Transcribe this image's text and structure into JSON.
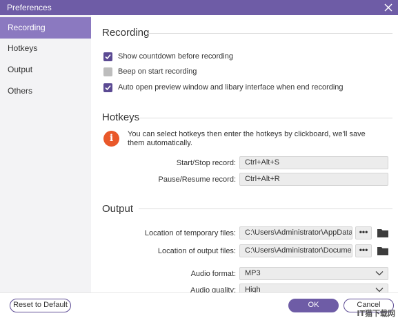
{
  "window": {
    "title": "Preferences"
  },
  "sidebar": {
    "items": [
      {
        "label": "Recording",
        "active": true
      },
      {
        "label": "Hotkeys",
        "active": false
      },
      {
        "label": "Output",
        "active": false
      },
      {
        "label": "Others",
        "active": false
      }
    ]
  },
  "recording": {
    "title": "Recording",
    "options": [
      {
        "label": "Show countdown before recording",
        "checked": true
      },
      {
        "label": "Beep on start recording",
        "checked": false
      },
      {
        "label": "Auto open preview window and libary interface when end recording",
        "checked": true
      }
    ]
  },
  "hotkeys": {
    "title": "Hotkeys",
    "info": "You can select hotkeys then enter the hotkeys by clickboard, we'll save them automatically.",
    "start_stop_label": "Start/Stop record:",
    "start_stop_value": "Ctrl+Alt+S",
    "pause_resume_label": "Pause/Resume record:",
    "pause_resume_value": "Ctrl+Alt+R"
  },
  "output": {
    "title": "Output",
    "temp_label": "Location of temporary files:",
    "temp_value": "C:\\Users\\Administrator\\AppData\\Lo",
    "output_label": "Location of output files:",
    "output_value": "C:\\Users\\Administrator\\Documents",
    "dots": "•••",
    "audio_format_label": "Audio format:",
    "audio_format_value": "MP3",
    "audio_quality_label": "Audio quality:",
    "audio_quality_value": "High"
  },
  "footer": {
    "reset_label": "Reset to Default",
    "ok_label": "OK",
    "cancel_label": "Cancel",
    "watermark": "IT猫下载网"
  },
  "colors": {
    "accent": "#6e5ca6",
    "sidebar_active": "#8b79c0",
    "checkbox_on": "#5b4a93",
    "info_orange": "#e9582a"
  },
  "icons": {
    "close": "close-icon",
    "check": "check-icon",
    "info": "info-icon",
    "folder": "folder-icon",
    "chevron": "chevron-down-icon"
  }
}
